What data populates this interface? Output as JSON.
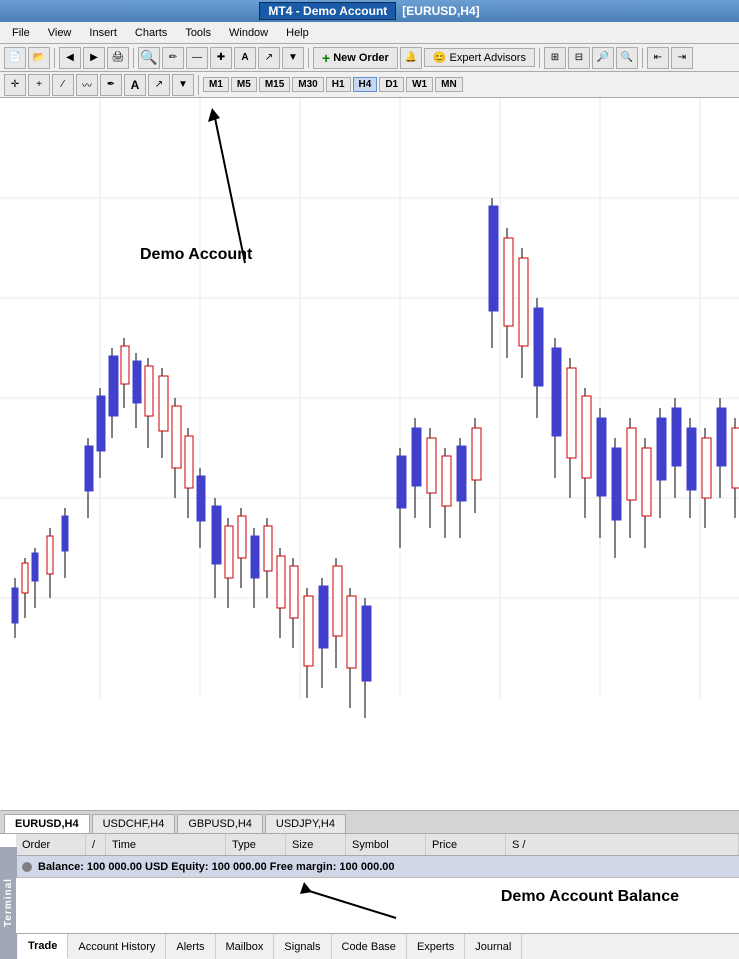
{
  "titleBar": {
    "title": "MT4 - Demo Account",
    "extra": "[EURUSD,H4]"
  },
  "menuBar": {
    "items": [
      "File",
      "View",
      "Insert",
      "Charts",
      "Tools",
      "Window",
      "Help"
    ]
  },
  "toolbar1": {
    "newOrderLabel": "New Order",
    "expertAdvisorsLabel": "Expert Advisors"
  },
  "toolbar2": {
    "timeframes": [
      "M1",
      "M5",
      "M15",
      "M30",
      "H1",
      "H4",
      "D1",
      "W1",
      "MN"
    ],
    "active": "H4"
  },
  "chartTabs": {
    "tabs": [
      "EURUSD,H4",
      "USDCHF,H4",
      "GBPUSD,H4",
      "USDJPY,H4"
    ],
    "active": "EURUSD,H4"
  },
  "terminalHeader": {
    "columns": [
      "Order",
      "/",
      "Time",
      "Type",
      "Size",
      "Symbol",
      "Price",
      "S /"
    ]
  },
  "terminalBalance": {
    "text": "Balance: 100 000.00 USD  Equity: 100 000.00  Free margin: 100 000.00"
  },
  "annotations": {
    "demoAccount": "Demo Account",
    "demoAccountBalance": "Demo Account Balance"
  },
  "terminalTabs": {
    "tabs": [
      "Trade",
      "Account History",
      "Alerts",
      "Mailbox",
      "Signals",
      "Code Base",
      "Experts",
      "Journal"
    ],
    "active": "Trade"
  },
  "terminalLabel": "Terminal"
}
